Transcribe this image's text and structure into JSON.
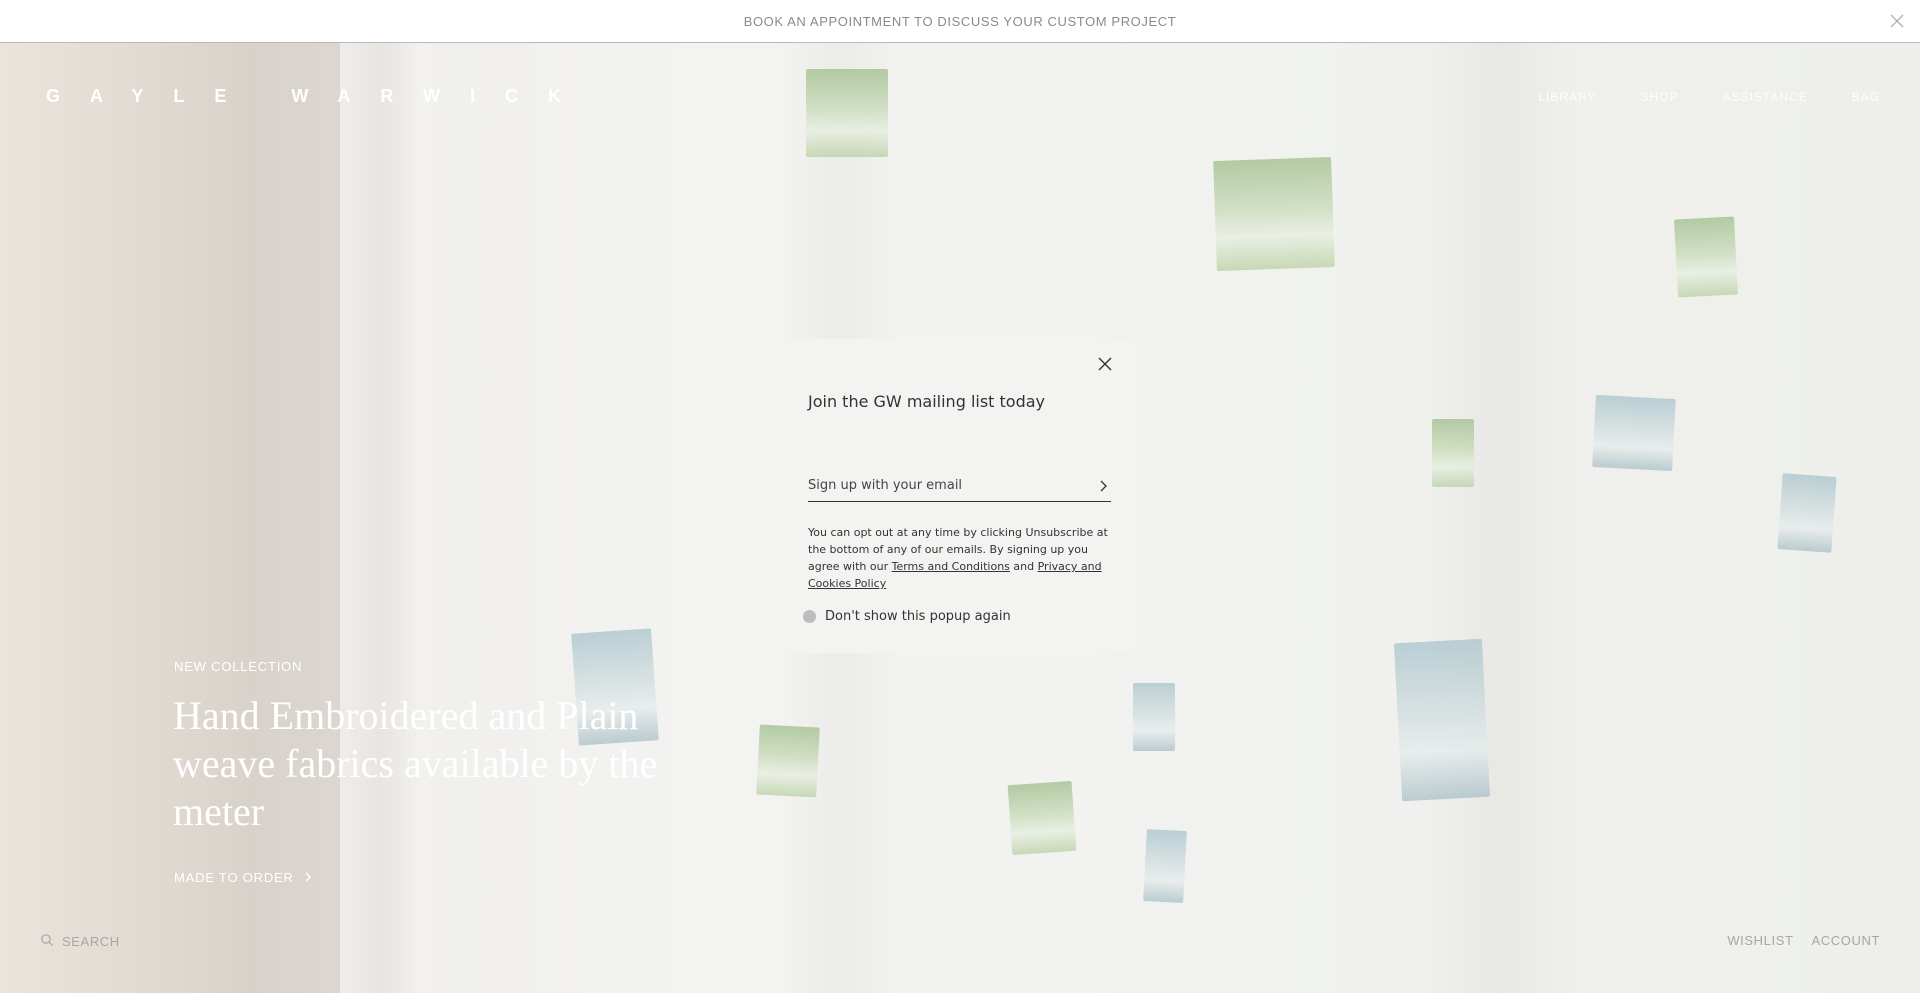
{
  "announcement": {
    "text": "BOOK AN APPOINTMENT TO DISCUSS YOUR CUSTOM PROJECT"
  },
  "header": {
    "logo": "GAYLE WARWICK",
    "nav": [
      {
        "label": "LIBRARY"
      },
      {
        "label": "SHOP"
      },
      {
        "label": "ASSISTANCE"
      },
      {
        "label": "BAG"
      }
    ]
  },
  "hero": {
    "eyebrow": "NEW COLLECTION",
    "headline": "Hand Embroidered and Plain weave fabrics available by the meter",
    "cta_label": "MADE TO ORDER"
  },
  "footer": {
    "search_label": "SEARCH",
    "wishlist_label": "WISHLIST",
    "account_label": "ACCOUNT"
  },
  "modal": {
    "title": "Join the GW mailing list today",
    "email_placeholder": "Sign up with your email",
    "legal_prefix": "You can opt out at any time by clicking Unsubscribe at the bottom of any of our emails. By signing up you agree with our ",
    "terms_label": "Terms and Conditions",
    "legal_and": " and ",
    "privacy_label": "Privacy and Cookies Policy",
    "dont_show_label": "Don't show this popup again"
  },
  "colors": {
    "modal_bg": "#f3f3f2",
    "text_dark": "#333333",
    "announcement_text": "#8a8a8a",
    "patch_green": "#9ebd8a",
    "patch_blue": "#a8c3cb"
  }
}
